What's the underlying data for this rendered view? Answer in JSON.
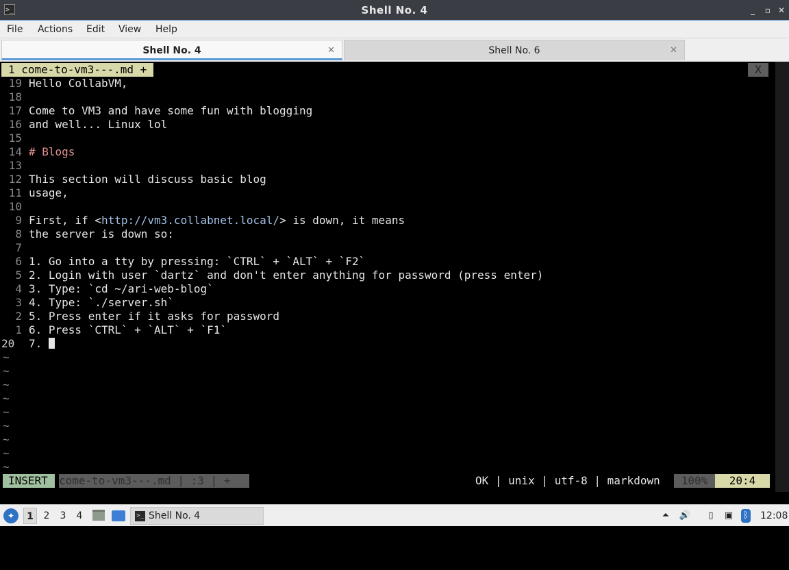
{
  "window": {
    "title": "Shell No. 4",
    "icon": "terminal-icon",
    "minimize": "_",
    "maximize": "▫",
    "restore": "◻",
    "close": "✕"
  },
  "menu": [
    "File",
    "Actions",
    "Edit",
    "View",
    "Help"
  ],
  "tabs": [
    {
      "label": "Shell No. 4",
      "close": "✕"
    },
    {
      "label": "Shell No. 6",
      "close": "✕"
    }
  ],
  "editor": {
    "tabline": "1 come-to-vm3---.md +",
    "close_button": "X",
    "lines": [
      {
        "num": "19",
        "text": "Hello CollabVM,"
      },
      {
        "num": "18",
        "text": ""
      },
      {
        "num": "17",
        "text": "Come to VM3 and have some fun with blogging"
      },
      {
        "num": "16",
        "text": "and well... Linux lol"
      },
      {
        "num": "15",
        "text": ""
      },
      {
        "num": "14",
        "text": "# Blogs"
      },
      {
        "num": "13",
        "text": ""
      },
      {
        "num": "12",
        "text": "This section will discuss basic blog"
      },
      {
        "num": "11",
        "text": "usage,"
      },
      {
        "num": "10",
        "text": ""
      },
      {
        "num": "9",
        "pre": "First, if <",
        "url": "http://vm3.collabnet.local/",
        "post": "> is down, it means"
      },
      {
        "num": "8",
        "text": "the server is down so:"
      },
      {
        "num": "7",
        "text": ""
      },
      {
        "num": "6",
        "text": "1. Go into a tty by pressing: `CTRL` + `ALT` + `F2`"
      },
      {
        "num": "5",
        "text": "2. Login with user `dartz` and don't enter anything for password (press enter)"
      },
      {
        "num": "4",
        "text": "3. Type: `cd ~/ari-web-blog`"
      },
      {
        "num": "3",
        "text": "4. Type: `./server.sh`"
      },
      {
        "num": "2",
        "text": "5. Press enter if it asks for password"
      },
      {
        "num": "1",
        "text": "6. Press `CTRL` + `ALT` + `F1`"
      }
    ],
    "current_line": {
      "num": "20",
      "text": "7. "
    },
    "tilde": "~",
    "status": {
      "mode": "INSERT",
      "file": "come-to-vm3---.md | :3 | +",
      "info": "OK | unix | utf-8 | markdown",
      "percent": "100%",
      "position": "20:4"
    }
  },
  "taskbar": {
    "workspaces": [
      "1",
      "2",
      "3",
      "4"
    ],
    "task_label": "Shell No. 4",
    "clock": "12:08",
    "tray_icons": [
      "upload-icon",
      "volume-icon",
      "clipboard-icon",
      "network-icon",
      "bluetooth-icon"
    ]
  }
}
